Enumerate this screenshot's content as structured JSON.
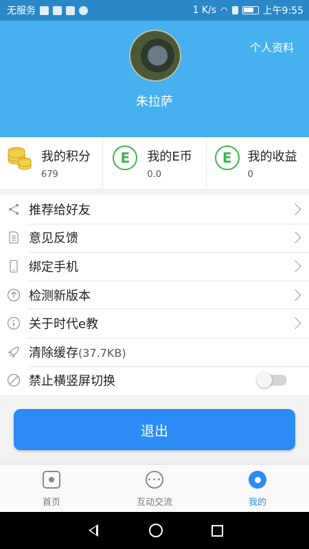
{
  "status_bar": {
    "carrier": "无服务",
    "speed": "1 K/s",
    "time": "上午9:55"
  },
  "header": {
    "profile_link": "个人资料",
    "user_name": "朱拉萨",
    "background_color": "#46b1ee"
  },
  "stats": [
    {
      "icon": "coin-stack-icon",
      "title": "我的积分",
      "value": "679"
    },
    {
      "icon": "e-coin-icon",
      "glyph": "E",
      "title": "我的E币",
      "value": "0.0"
    },
    {
      "icon": "e-coin-icon",
      "glyph": "E",
      "title": "我的收益",
      "value": "0"
    }
  ],
  "menu": {
    "items": [
      {
        "icon": "share-icon",
        "label": "推荐给好友"
      },
      {
        "icon": "document-icon",
        "label": "意见反馈"
      },
      {
        "icon": "phone-icon",
        "label": "绑定手机"
      },
      {
        "icon": "upload-arrow-icon",
        "label": "检测新版本"
      },
      {
        "icon": "info-icon",
        "label": "关于时代e教"
      },
      {
        "icon": "rocket-icon",
        "label": "清除缓存",
        "extra": "(37.7KB)"
      },
      {
        "icon": "forbidden-icon",
        "label": "禁止横竖屏切换",
        "toggle": false
      }
    ]
  },
  "logout_label": "退出",
  "tabs": [
    {
      "icon": "home-icon",
      "label": "首页",
      "active": false
    },
    {
      "icon": "chat-icon",
      "label": "互动交流",
      "active": false
    },
    {
      "icon": "user-icon",
      "label": "我的",
      "active": true
    }
  ],
  "accent_color": "#2b8cf5"
}
